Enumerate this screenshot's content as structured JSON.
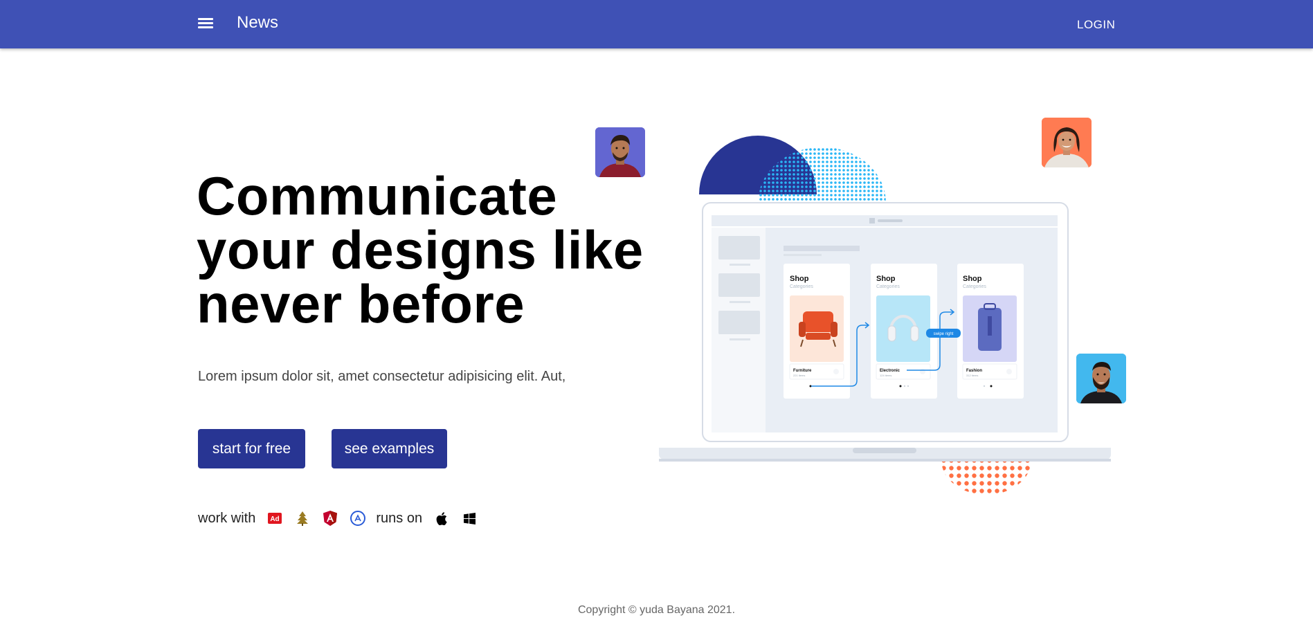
{
  "header": {
    "title": "News",
    "login_label": "LOGIN",
    "background": "#3f51b5"
  },
  "hero": {
    "headline_lines": [
      "Communicate",
      "your designs like",
      "never before"
    ],
    "lead": "Lorem ipsum dolor sit, amet consectetur adipisicing elit. Aut,",
    "start_label": "start for free",
    "examples_label": "see examples",
    "button_color": "#283593"
  },
  "integrations": {
    "work_with_label": "work with",
    "runs_on_label": "runs on",
    "work_with_icons": [
      "adobe-icon",
      "tree-icon",
      "angular-icon",
      "appstore-icon"
    ],
    "runs_on_icons": [
      "apple-icon",
      "windows-icon"
    ],
    "adobe_badge_text": "Ad"
  },
  "illustration": {
    "screens": [
      {
        "title": "Shop",
        "subtitle": "Categories",
        "product": "Furniture",
        "product_sub": "221 items"
      },
      {
        "title": "Shop",
        "subtitle": "Categories",
        "product": "Electronic",
        "product_sub": "124 items"
      },
      {
        "title": "Shop",
        "subtitle": "Categories",
        "product": "Fashion",
        "product_sub": "312 items"
      }
    ],
    "swipe_label": "swipe right"
  },
  "footer": {
    "copyright": "Copyright © yuda Bayana 2021."
  }
}
